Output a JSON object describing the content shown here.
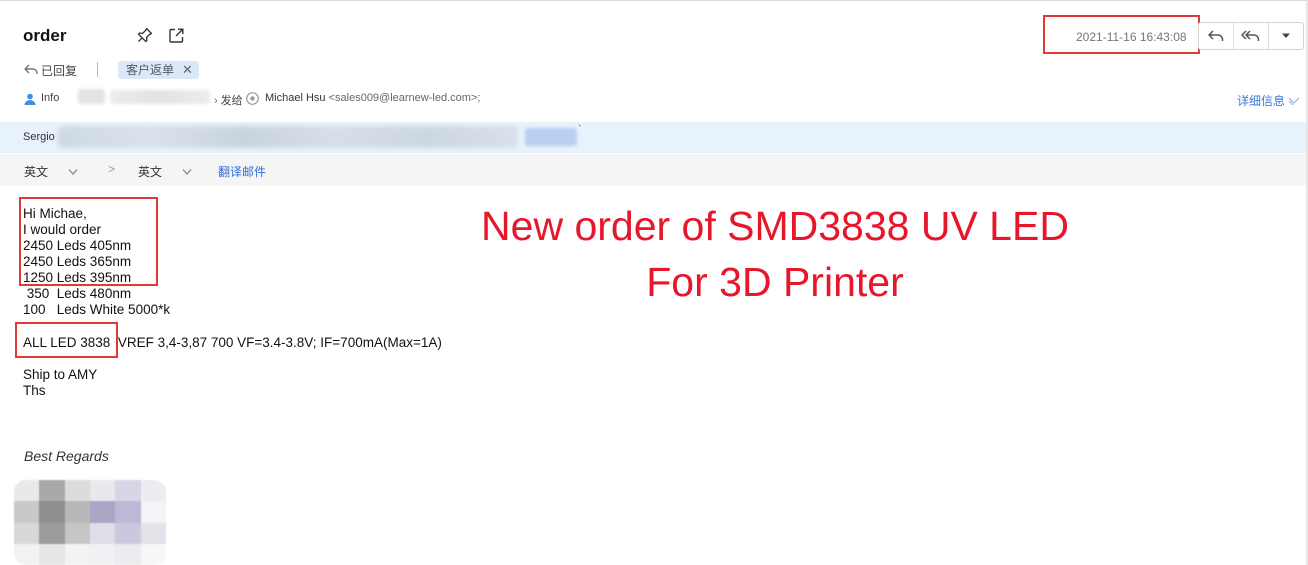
{
  "email": {
    "subject": "order",
    "datetime": "2021-11-16 16:43:08",
    "status": "已回复",
    "tag": "客户返单",
    "from_name": "Info",
    "send_to_label": "发给",
    "recipient_name": "Michael Hsu",
    "recipient_addr": "<sales009@learnew-led.com>;",
    "details_link": "详细信息",
    "notice_name": "Sergio",
    "notice_mark": "`"
  },
  "translate": {
    "source_lang": "英文",
    "target_lang": "英文",
    "arrow": ">",
    "action": "翻译邮件"
  },
  "body": {
    "lines": [
      "Hi Michae,",
      "I would order",
      "2450 Leds 405nm",
      "2450 Leds 365nm",
      "1250 Leds 395nm",
      " 350  Leds 480nm",
      "100   Leds White 5000*k"
    ],
    "led_line": "ALL LED 3838  VREF 3,4-3,87 700 VF=3.4-3.8V; IF=700mA(Max=1A)",
    "ship": "Ship to AMY",
    "thanks": "Ths",
    "regards": "Best Regards"
  },
  "annotation": {
    "line1": "New order of SMD3838 UV LED",
    "line2": "For 3D Printer"
  },
  "colors": {
    "highlight": "#e03a3a",
    "annotation": "#e8162a",
    "link": "#2f6fd6",
    "notice_bg": "#e8f2fd",
    "tag_bg": "#dbe8f7"
  },
  "icons": [
    "pin-icon",
    "popout-icon",
    "reply-icon",
    "reply-all-icon",
    "dropdown-icon",
    "replied-status-icon",
    "tag-close-icon",
    "person-icon",
    "recipient-icon",
    "expand-chevron-icon",
    "chevron-down-icon"
  ]
}
